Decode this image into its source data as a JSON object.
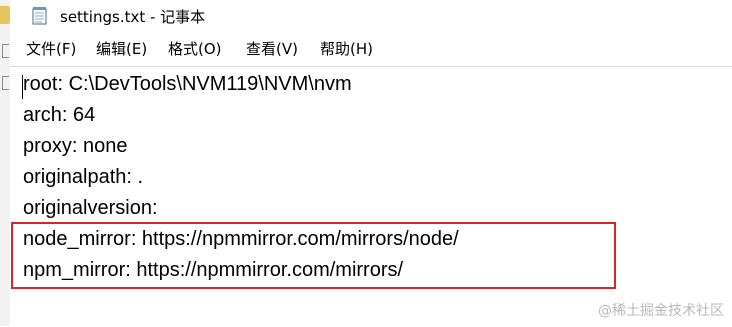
{
  "window": {
    "title": "settings.txt - 记事本",
    "icon": "notepad-icon"
  },
  "menu": {
    "items": [
      {
        "label": "文件(F)"
      },
      {
        "label": "编辑(E)"
      },
      {
        "label": "格式(O)"
      },
      {
        "label": "查看(V)"
      },
      {
        "label": "帮助(H)"
      }
    ]
  },
  "editor": {
    "lines": [
      "root: C:\\DevTools\\NVM119\\NVM\\nvm",
      "arch: 64",
      "proxy: none",
      "originalpath: .",
      "originalversion:",
      "node_mirror: https://npmmirror.com/mirrors/node/",
      "npm_mirror: https://npmmirror.com/mirrors/"
    ],
    "highlight_color": "#d9252a"
  },
  "watermark": "@稀土掘金技术社区"
}
